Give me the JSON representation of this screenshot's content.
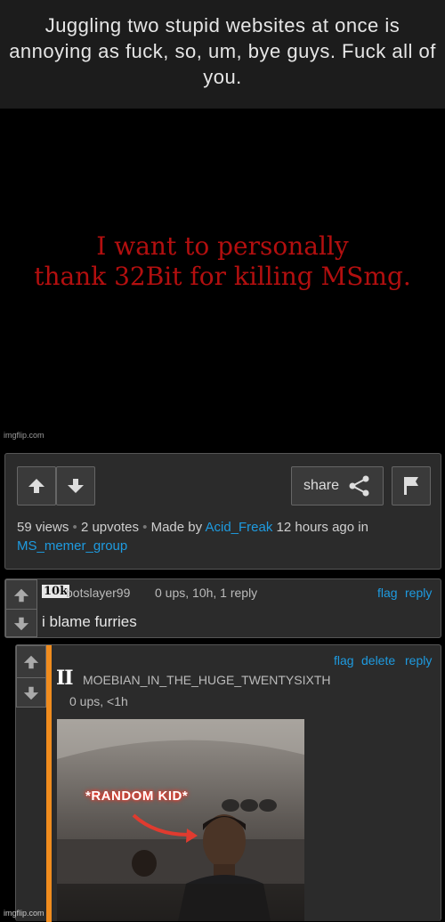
{
  "header_caption": "Juggling two stupid websites at once is annoying as fuck, so, um, bye guys. Fuck all of you.",
  "meme": {
    "text_line1": "I want to personally",
    "text_line2": "thank 32Bit for killing MSmg.",
    "watermark": "imgflip.com"
  },
  "post": {
    "share_label": "share",
    "views": "59 views",
    "upvotes": "2 upvotes",
    "made_by": "Made by",
    "author": "Acid_Freak",
    "time_ago": "12 hours ago in",
    "stream": "MS_memer_group"
  },
  "comment1": {
    "badge": "10k",
    "user": "botslayer99",
    "meta": "0 ups, 10h, 1 reply",
    "flag": "flag",
    "reply": "reply",
    "text": "i blame furries"
  },
  "comment2": {
    "badge": "II",
    "user": "MOEBIAN_IN_THE_HUGE_TWENTYSIXTH",
    "meta": "0 ups, <1h",
    "flag": "flag",
    "delete": "delete",
    "reply": "reply",
    "image_caption": "*RANDOM KID*",
    "watermark": "imgflip.com"
  },
  "colors": {
    "link": "#1e9be0",
    "meme_text": "#b30f0f",
    "accent_bar": "#f08c1e"
  },
  "icons": [
    "upvote-arrow-icon",
    "downvote-arrow-icon",
    "share-icon",
    "flag-icon"
  ]
}
